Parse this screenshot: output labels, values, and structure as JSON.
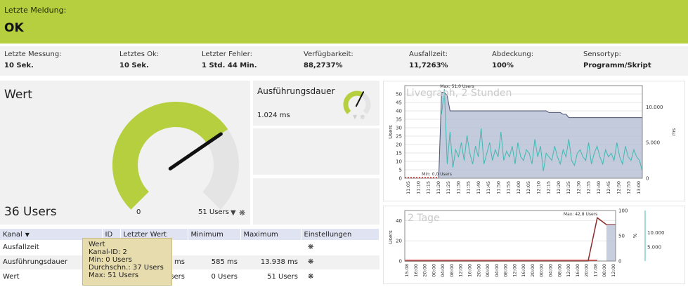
{
  "status": {
    "label": "Letzte Meldung:",
    "value": "OK"
  },
  "stats": [
    {
      "label": "Letzte Messung:",
      "value": "10 Sek."
    },
    {
      "label": "Letztes Ok:",
      "value": "10 Sek."
    },
    {
      "label": "Letzter Fehler:",
      "value": "1 Std. 44 Min."
    },
    {
      "label": "Verfügbarkeit:",
      "value": "88,2737%"
    },
    {
      "label": "Ausfallzeit:",
      "value": "11,7263%"
    },
    {
      "label": "Abdeckung:",
      "value": "100%"
    },
    {
      "label": "Sensortyp:",
      "value": "Programm/Skript"
    }
  ],
  "wert": {
    "title": "Wert",
    "value": "36 Users",
    "gauge_min": "0",
    "gauge_max": "51 Users",
    "gauge_level": 0.706,
    "gauge_max_marker": "M"
  },
  "exec": {
    "title": "Ausführungsdauer",
    "value": "1.024 ms",
    "gauge_level": 0.6
  },
  "table": {
    "headers": [
      "Kanal",
      "ID",
      "Letzter Wert",
      "Minimum",
      "Maximum",
      "Einstellungen"
    ],
    "rows": [
      {
        "kanal": "Ausfallzeit",
        "id": "",
        "last": "",
        "min": "",
        "max": ""
      },
      {
        "kanal": "Ausführungsdauer",
        "id": "",
        "last": "1.024 ms",
        "min": "585 ms",
        "max": "13.938 ms"
      },
      {
        "kanal": "Wert",
        "id": "",
        "last": "36 Users",
        "min": "0 Users",
        "max": "51 Users"
      }
    ]
  },
  "tooltip": {
    "lines": [
      "Wert",
      "Kanal-ID: 2",
      "Min: 0 Users",
      "Durchschn.: 37 Users",
      "Max: 51 Users"
    ]
  },
  "chart_data": [
    {
      "type": "area",
      "title": "Livegraph, 2 Stunden",
      "ylabel": "Users",
      "y2label": "ms",
      "ylim": [
        0,
        55
      ],
      "y2lim": [
        0,
        13000
      ],
      "yticks": [
        "0",
        "5",
        "10",
        "15",
        "20",
        "25",
        "30",
        "35",
        "40",
        "45",
        "50"
      ],
      "y2ticks": [
        "0",
        "5.000",
        "10.000"
      ],
      "x": [
        "11:05",
        "11:10",
        "11:15",
        "11:20",
        "11:25",
        "11:30",
        "11:35",
        "11:40",
        "11:45",
        "11:50",
        "11:55",
        "12:00",
        "12:05",
        "12:10",
        "12:15",
        "12:20",
        "12:25",
        "12:30",
        "12:35",
        "12:40",
        "12:45",
        "12:50",
        "12:55",
        "13:00"
      ],
      "annotations": {
        "max_label": "Max: 51,0 Users",
        "min_label": "Min: 0,0 Users"
      },
      "series": [
        {
          "values": [
            0,
            0,
            0,
            0,
            0,
            0,
            0,
            0,
            0,
            0,
            0,
            0,
            0,
            51,
            51,
            49,
            40,
            40,
            40,
            40,
            40,
            40,
            40,
            40,
            40,
            40,
            40,
            40,
            40,
            40,
            40,
            40,
            40,
            40,
            40,
            40,
            40,
            40,
            40,
            40,
            40,
            40,
            40,
            40,
            40,
            40,
            40,
            40,
            40,
            40,
            40,
            39,
            39,
            39,
            39,
            39,
            38,
            38,
            36,
            36,
            36,
            36,
            36,
            36,
            36,
            36,
            36,
            36,
            36,
            36,
            36,
            36,
            36,
            36,
            36,
            36,
            36,
            36,
            36,
            36,
            36,
            36,
            36,
            36,
            36
          ]
        },
        {
          "values": [
            0,
            0,
            0,
            0,
            0,
            0,
            0,
            0,
            0,
            0,
            0,
            0,
            0,
            9000,
            12500,
            2000,
            6500,
            1500,
            4000,
            3000,
            5000,
            2500,
            6000,
            3500,
            2000,
            4500,
            3000,
            7000,
            2000,
            3500,
            5000,
            2500,
            4000,
            3000,
            6500,
            2500,
            3800,
            3000,
            4500,
            2000,
            5000,
            3000,
            2500,
            4000,
            3500,
            2000,
            5500,
            3000,
            4500,
            1000,
            3500,
            3000,
            2500,
            4500,
            3000,
            2000,
            4000,
            3000,
            5500,
            2500,
            1800,
            3500,
            4000,
            3000,
            2500,
            5000,
            2000,
            3500,
            4500,
            3000,
            2000,
            4000,
            3000,
            3500,
            2500,
            5000,
            3000,
            2000,
            4500,
            3000,
            2500,
            4000,
            3000,
            2500,
            1000
          ]
        }
      ]
    },
    {
      "type": "line",
      "title": "2 Tage",
      "ylabel": "Users",
      "y2label": "%",
      "ylim": [
        0,
        50
      ],
      "y2lim": [
        0,
        15000
      ],
      "yticks": [
        "0",
        "20",
        "40"
      ],
      "pctticks": [
        "0",
        "50",
        "100"
      ],
      "y2ticks": [
        "5.000",
        "10.000"
      ],
      "x": [
        "15.08",
        "16:00",
        "20:00",
        "00:00",
        "04:00",
        "08:00",
        "12:00",
        "16:00",
        "20:00",
        "00:00",
        "04:00",
        "08:00",
        "12:00",
        "16:00",
        "20:00",
        "00:00",
        "04:00",
        "08:00",
        "12:00",
        "16:00",
        "20:00",
        "17.08",
        "08:00",
        "12:00"
      ],
      "annotations": {
        "max_label": "Max: 42,8 Users"
      },
      "series": [
        {
          "values": [
            0,
            0,
            0,
            0,
            0,
            0,
            0,
            0,
            0,
            0,
            0,
            0,
            0,
            0,
            0,
            0,
            0,
            0,
            0,
            0,
            0,
            42.8,
            36,
            36
          ]
        }
      ]
    }
  ]
}
